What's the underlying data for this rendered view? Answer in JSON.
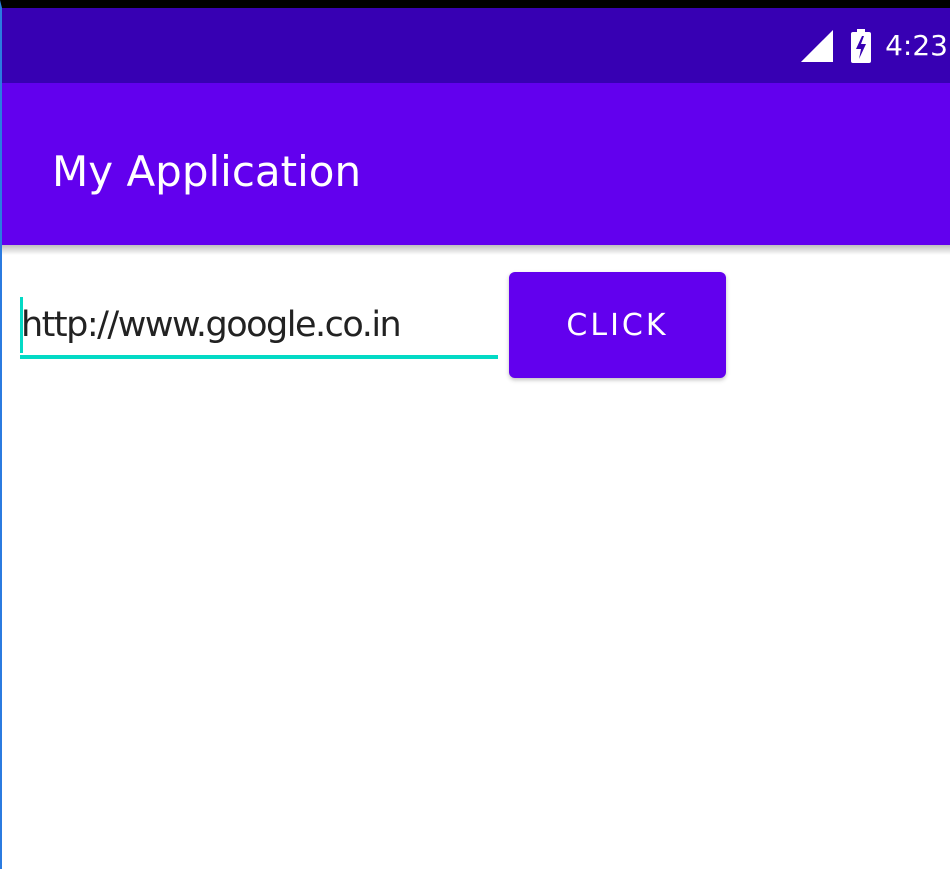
{
  "status_bar": {
    "time": "4:23",
    "icons": [
      "signal-icon",
      "battery-charging-icon"
    ],
    "color": "#3700b3"
  },
  "app_bar": {
    "title": "My Application",
    "color": "#6200ee"
  },
  "url_input": {
    "value": "http://www.google.co.in",
    "underline_color": "#03dac5"
  },
  "click_button": {
    "label": "CLICK",
    "color": "#6200ee"
  }
}
